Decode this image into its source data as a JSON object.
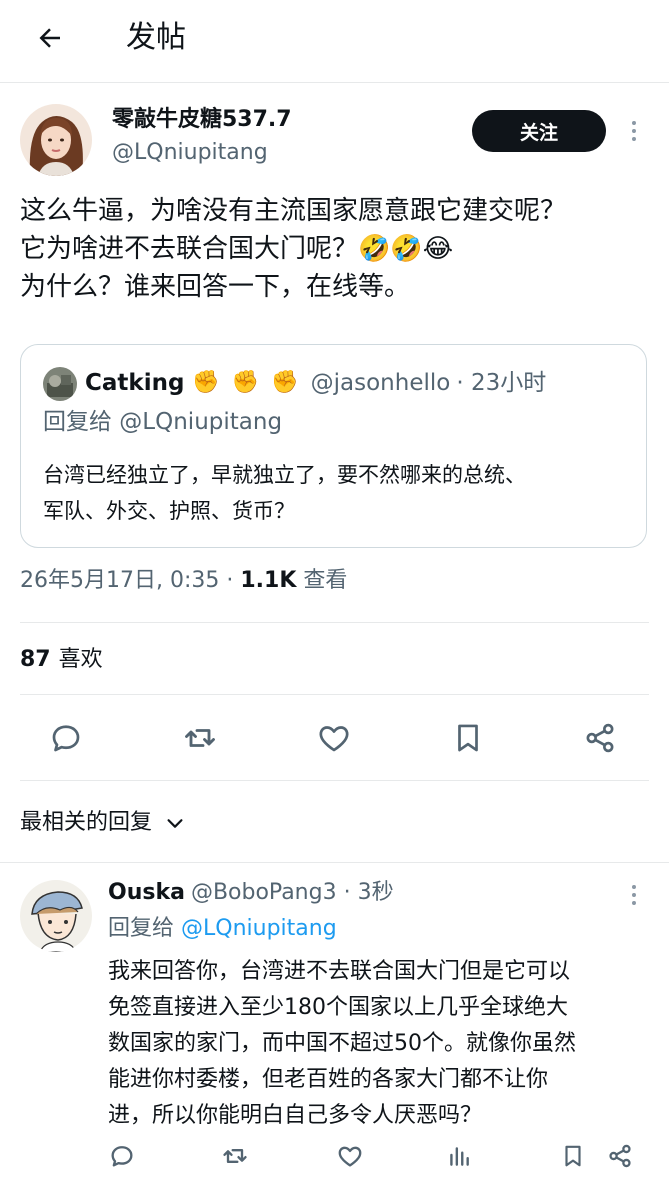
{
  "header": {
    "title": "发帖",
    "back_icon": "arrow-left-icon"
  },
  "post": {
    "author_name": "零敲牛皮糖537.7",
    "author_handle": "@LQniupitang",
    "follow_label": "关注",
    "text": "这么牛逼，为啥没有主流国家愿意跟它建交呢？\n它为啥进不去联合国大门呢？🤣🤣😂\n为什么？谁来回答一下，在线等。",
    "quote": {
      "name": "Catking",
      "emoji": "✊",
      "handle": "@jasonhello",
      "time": "· 23小时",
      "reply_to": "回复给 @LQniupitang",
      "text": "台湾已经独立了，早就独立了，要不然哪来的总统、\n军队、外交、护照、货币？"
    },
    "timestamp": "26年5月17日, 0:35 · ",
    "views_count": "1.1K",
    "views_label": " 查看",
    "likes_count": "87",
    "likes_label": "喜欢"
  },
  "actions": {
    "reply_icon": "reply-icon",
    "repost_icon": "repost-icon",
    "like_icon": "heart-icon",
    "bookmark_icon": "bookmark-icon",
    "share_icon": "share-icon"
  },
  "replies_sort": {
    "label": "最相关的回复",
    "icon": "chevron-down-icon"
  },
  "reply": {
    "name": "Ouska",
    "handle": "@BoboPang3",
    "time": "· 3秒",
    "reply_to_prefix": "回复给 ",
    "reply_to_handle": "@LQniupitang",
    "text": "我来回答你，台湾进不去联合国大门但是它可以\n免签直接进入至少180个国家以上几乎全球绝大\n数国家的家门，而中国不超过50个。就像你虽然\n能进你村委楼，但老百姓的各家大门都不让你\n进，所以你能明白自己多令人厌恶吗？"
  },
  "colors": {
    "accent_link": "#1d9bf0",
    "muted": "#536471",
    "text": "#0f1419"
  }
}
